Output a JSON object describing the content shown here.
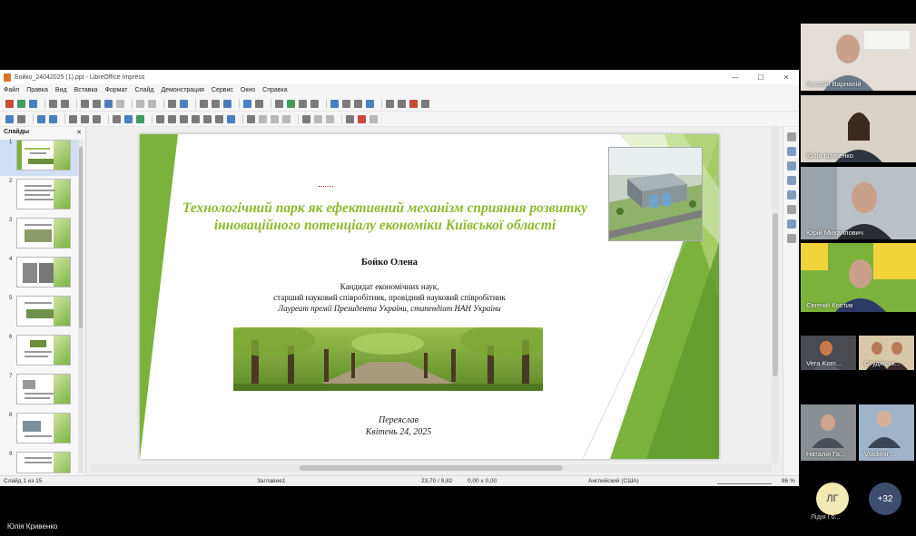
{
  "window": {
    "title": "Бойко_24042025 (1).ppt - LibreOffice Impress",
    "minimize": "—",
    "maximize": "☐",
    "close": "✕"
  },
  "menu": [
    "Файл",
    "Правка",
    "Вид",
    "Вставка",
    "Формат",
    "Слайд",
    "Демонстрация",
    "Сервис",
    "Окно",
    "Справка"
  ],
  "slides_pane": {
    "header": "Слайды",
    "close": "✕",
    "numbers": [
      "1",
      "2",
      "3",
      "4",
      "5",
      "6",
      "7",
      "8",
      "9"
    ]
  },
  "slide": {
    "title_line1": "Технологічний парк як ефективний механізм сприяння розвитку",
    "title_line2": "інноваційного потенціалу економіки Київської області",
    "author": "Бойко Олена",
    "cred_line1": "Кандидат економічних наук,",
    "cred_line2": "старший науковий співробітник, провідний науковий співробітник",
    "cred_line3": "Лауреат премії Президента України, стипендіат НАН України",
    "place": "Переяслав",
    "date": "Квітень 24, 2025"
  },
  "statusbar": {
    "slide_info": "Слайд 1 из 15",
    "layout": "Заглавие1",
    "position": "23,70 / 9,82",
    "size": "0,00 x 0,00",
    "language": "Английский (США)",
    "zoom": "86 %"
  },
  "participants": [
    {
      "name": "Захарій Варналій"
    },
    {
      "name": "Юлія Кривенко"
    },
    {
      "name": "Юрій Михайлович"
    },
    {
      "name": "Євгеній Костик"
    },
    {
      "name": "Vera Kom..."
    },
    {
      "name": "Студінськ..."
    },
    {
      "name": "Наталія Га..."
    },
    {
      "name": "Vladimir ..."
    },
    {
      "name": "Лідія Го...",
      "initials": "ЛГ"
    }
  ],
  "more_participants": "+32",
  "presenter_name": "Юлія  Кривенко",
  "colors": {
    "slide_green": "#7ab23c",
    "title_green": "#8fb82e",
    "avatar_bg": "#f3e9b4",
    "more_bg": "#3d4d6e"
  }
}
